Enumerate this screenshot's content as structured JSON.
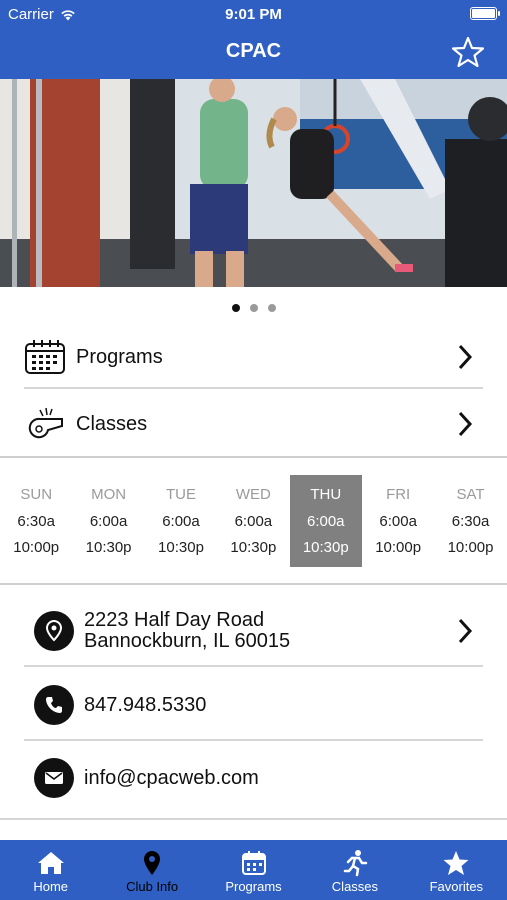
{
  "status_bar": {
    "carrier": "Carrier",
    "time": "9:01 PM"
  },
  "nav": {
    "title": "CPAC"
  },
  "menu": {
    "programs": "Programs",
    "classes": "Classes"
  },
  "hours": [
    {
      "day": "SUN",
      "open": "6:30a",
      "close": "10:00p"
    },
    {
      "day": "MON",
      "open": "6:00a",
      "close": "10:30p"
    },
    {
      "day": "TUE",
      "open": "6:00a",
      "close": "10:30p"
    },
    {
      "day": "WED",
      "open": "6:00a",
      "close": "10:30p"
    },
    {
      "day": "THU",
      "open": "6:00a",
      "close": "10:30p"
    },
    {
      "day": "FRI",
      "open": "6:00a",
      "close": "10:00p"
    },
    {
      "day": "SAT",
      "open": "6:30a",
      "close": "10:00p"
    }
  ],
  "contact": {
    "address_line1": "2223 Half Day Road",
    "address_line2": "Bannockburn, IL 60015",
    "phone": "847.948.5330",
    "email": "info@cpacweb.com"
  },
  "tabs": [
    {
      "label": "Home",
      "icon": "home-icon"
    },
    {
      "label": "Club Info",
      "icon": "location-pin-icon"
    },
    {
      "label": "Programs",
      "icon": "calendar-icon"
    },
    {
      "label": "Classes",
      "icon": "runner-icon"
    },
    {
      "label": "Favorites",
      "icon": "star-icon"
    }
  ],
  "colors": {
    "brand_blue": "#2f5fc3",
    "selected_day": "#808080"
  }
}
